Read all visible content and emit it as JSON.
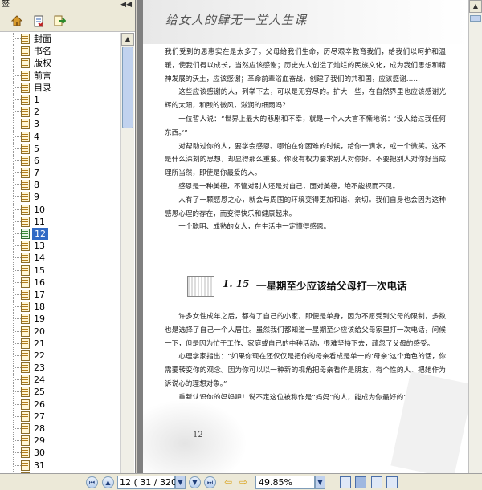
{
  "panel": {
    "title": "签",
    "collapse_glyph": "◀◀"
  },
  "bookmarks": [
    {
      "label": "封面"
    },
    {
      "label": "书名"
    },
    {
      "label": "版权"
    },
    {
      "label": "前言"
    },
    {
      "label": "目录"
    },
    {
      "label": "1"
    },
    {
      "label": "2"
    },
    {
      "label": "3"
    },
    {
      "label": "4"
    },
    {
      "label": "5"
    },
    {
      "label": "6"
    },
    {
      "label": "7"
    },
    {
      "label": "8"
    },
    {
      "label": "9"
    },
    {
      "label": "10"
    },
    {
      "label": "11"
    },
    {
      "label": "12",
      "selected": true
    },
    {
      "label": "13"
    },
    {
      "label": "14"
    },
    {
      "label": "15"
    },
    {
      "label": "16"
    },
    {
      "label": "17"
    },
    {
      "label": "18"
    },
    {
      "label": "19"
    },
    {
      "label": "20"
    },
    {
      "label": "21"
    },
    {
      "label": "22"
    },
    {
      "label": "23"
    },
    {
      "label": "24"
    },
    {
      "label": "25"
    },
    {
      "label": "26"
    },
    {
      "label": "27"
    },
    {
      "label": "28"
    },
    {
      "label": "29"
    },
    {
      "label": "30"
    },
    {
      "label": "31"
    },
    {
      "label": "32"
    }
  ],
  "document": {
    "header_title": "给女人的肆无一堂人生课",
    "paragraphs_top": [
      "我们受到的恩惠实在是太多了。父母给我们生命，历尽艰辛教育我们，给我们以呵护和温暖，使我们得以成长，当然应该感谢；历史先人创造了灿烂的民族文化，成为我们思想和精神发展的沃土，应该感谢；革命前辈浴血奋战，创建了我们的共和国，应该感谢……",
      "这些应该感谢的人，列举下去，可以是无穷尽的。扩大一些，在自然界里也应该感谢光辉的太阳，和煦的微风，滋润的细雨吗？",
      "一位哲人说：“世界上最大的悲剧和不幸，就是一个人大言不惭地说：‘没人给过我任何东西。’”",
      "对帮助过你的人，要学会感恩。哪怕在你困难的时候，给你一滴水，或一个微笑。这不是什么深刻的思想，却显得那么重要。你没有权力要求别人对你好。不要把别人对你好当成理所当然，即使是你最爱的人。",
      "感恩是一种美德，不管对别人还是对自己，面对美德，绝不能视而不见。",
      "人有了一颗感恩之心，就会与周围的环境变得更加和谐、亲切。我们自身也会因为这种感恩心理的存在，而变得快乐和健康起来。",
      "一个聪明、成熟的女人，在生活中一定懂得感恩。"
    ],
    "section_number": "1. 15",
    "section_title": "一星期至少应该给父母打一次电话",
    "paragraphs_bottom": [
      "许多女性成年之后，都有了自己的小家，即便是单身，因为不愿受到父母的限制，多数也是选择了自己一个人居住。虽然我们都知道一星期至少应该给父母家里打一次电话，问候一下，但是因为忙于工作、家庭或自己的中种活动，很难坚持下去，疏忽了父母的感受。",
      "心理学家指出：“如果你现在还仅仅是把你的母亲看成是单一的‘母亲’这个角色的话，你需要转变你的观念。因为你可以以一种新的视角把母亲看作是朋友、有个性的人，把她作为诉说心的理想对象。”",
      "重新认识你的妈妈吧！说不定这位被称作是“妈妈”的人，能成为你最好的“煲电话粥”的朋友呢！"
    ],
    "page_number": "12"
  },
  "statusbar": {
    "page_display": "12 ( 31 / 320 )",
    "zoom": "49.85%"
  },
  "colors": {
    "selection": "#316ac5",
    "chrome": "#ece9d8",
    "doc_bg": "#808080"
  },
  "icons": [
    "home-icon",
    "delete-icon",
    "export-icon",
    "first-page-icon",
    "prev-page-icon",
    "next-page-icon",
    "last-page-icon",
    "back-icon",
    "forward-icon",
    "single-page-icon",
    "continuous-icon",
    "facing-icon",
    "continuous-facing-icon"
  ]
}
